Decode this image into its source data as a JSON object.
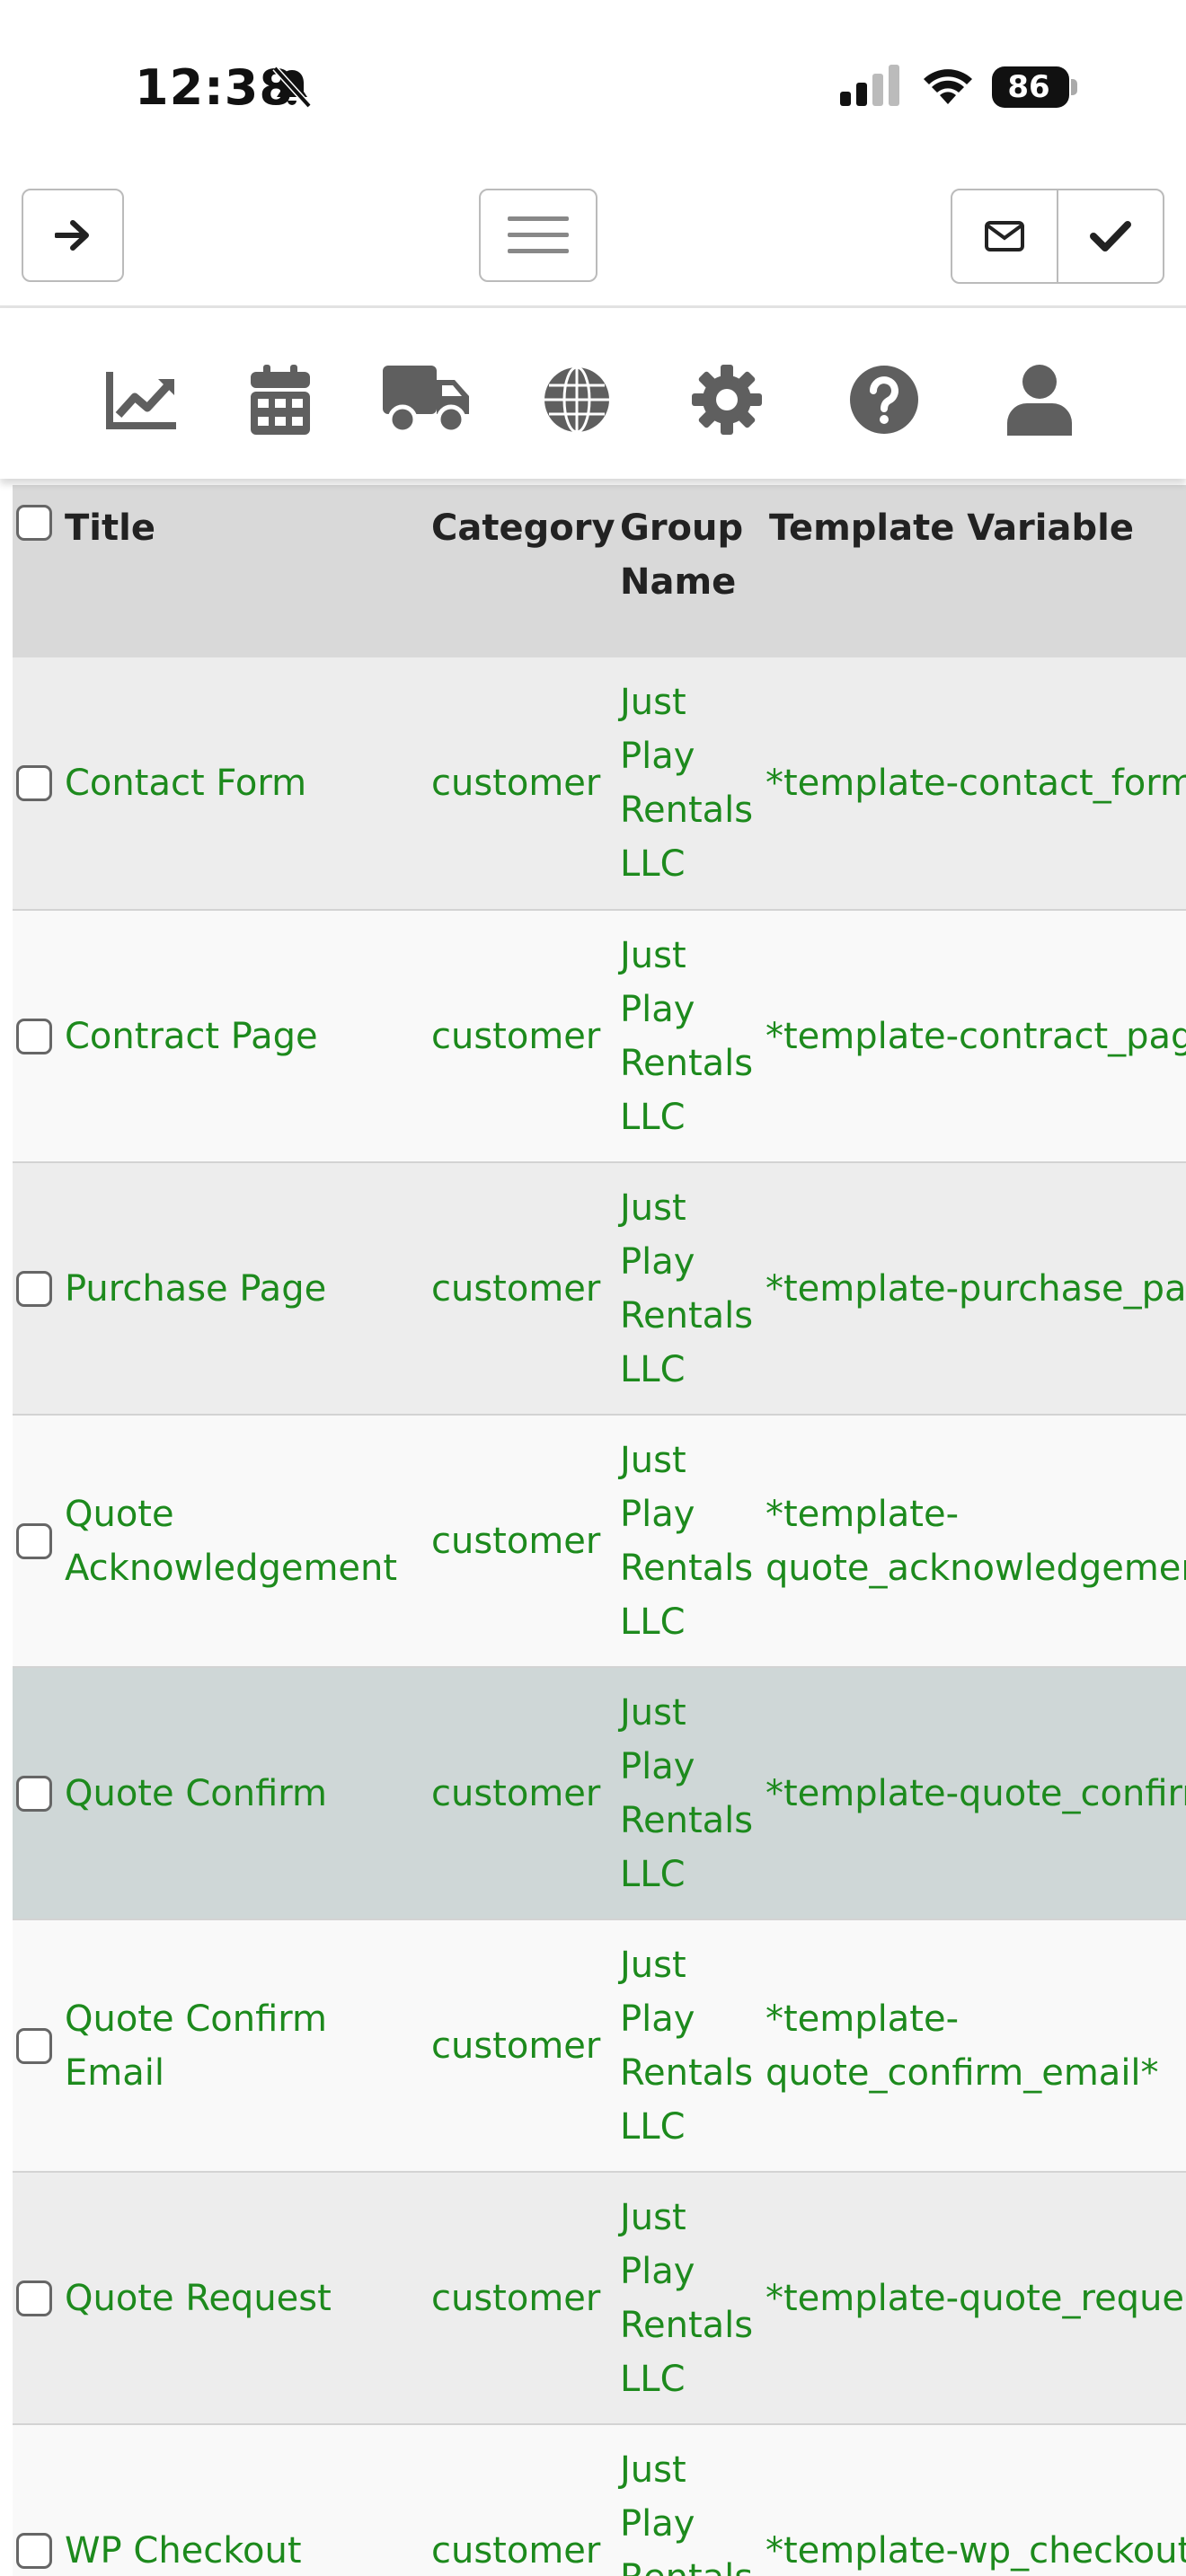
{
  "status": {
    "time": "12:38",
    "battery": "86"
  },
  "icons": {
    "back": "arrow-right-icon",
    "menu": "hamburger-menu-icon",
    "mail": "envelope-icon",
    "check": "checkmark-icon",
    "nav": [
      "chart-line-icon",
      "calendar-icon",
      "truck-icon",
      "globe-icon",
      "gear-icon",
      "question-circle-icon",
      "user-icon"
    ]
  },
  "table": {
    "headers": {
      "title": "Title",
      "category": "Category",
      "group": "Group Name",
      "template": "Template Variable"
    },
    "rows": [
      {
        "title": "Contact Form",
        "category": "customer",
        "group": "Just Play Rentals LLC",
        "template": "*template-contact_form*"
      },
      {
        "title": "Contract Page",
        "category": "customer",
        "group": "Just Play Rentals LLC",
        "template": "*template-contract_page*"
      },
      {
        "title": "Purchase Page",
        "category": "customer",
        "group": "Just Play Rentals LLC",
        "template": "*template-purchase_page*"
      },
      {
        "title": "Quote Acknowledgement",
        "category": "customer",
        "group": "Just Play Rentals LLC",
        "template": "*template-quote_acknowledgement*"
      },
      {
        "title": "Quote Confirm",
        "category": "customer",
        "group": "Just Play Rentals LLC",
        "template": "*template-quote_confirm*"
      },
      {
        "title": "Quote Confirm Email",
        "category": "customer",
        "group": "Just Play Rentals LLC",
        "template": "*template-quote_confirm_email*"
      },
      {
        "title": "Quote Request",
        "category": "customer",
        "group": "Just Play Rentals LLC",
        "template": "*template-quote_request*"
      },
      {
        "title": "WP Checkout",
        "category": "customer",
        "group": "Just Play Rentals LLC",
        "template": "*template-wp_checkout*"
      }
    ]
  },
  "colors": {
    "link": "#1d8a1d",
    "header_bg": "#d9d9d9",
    "selected_row": "#cfd7d7"
  }
}
